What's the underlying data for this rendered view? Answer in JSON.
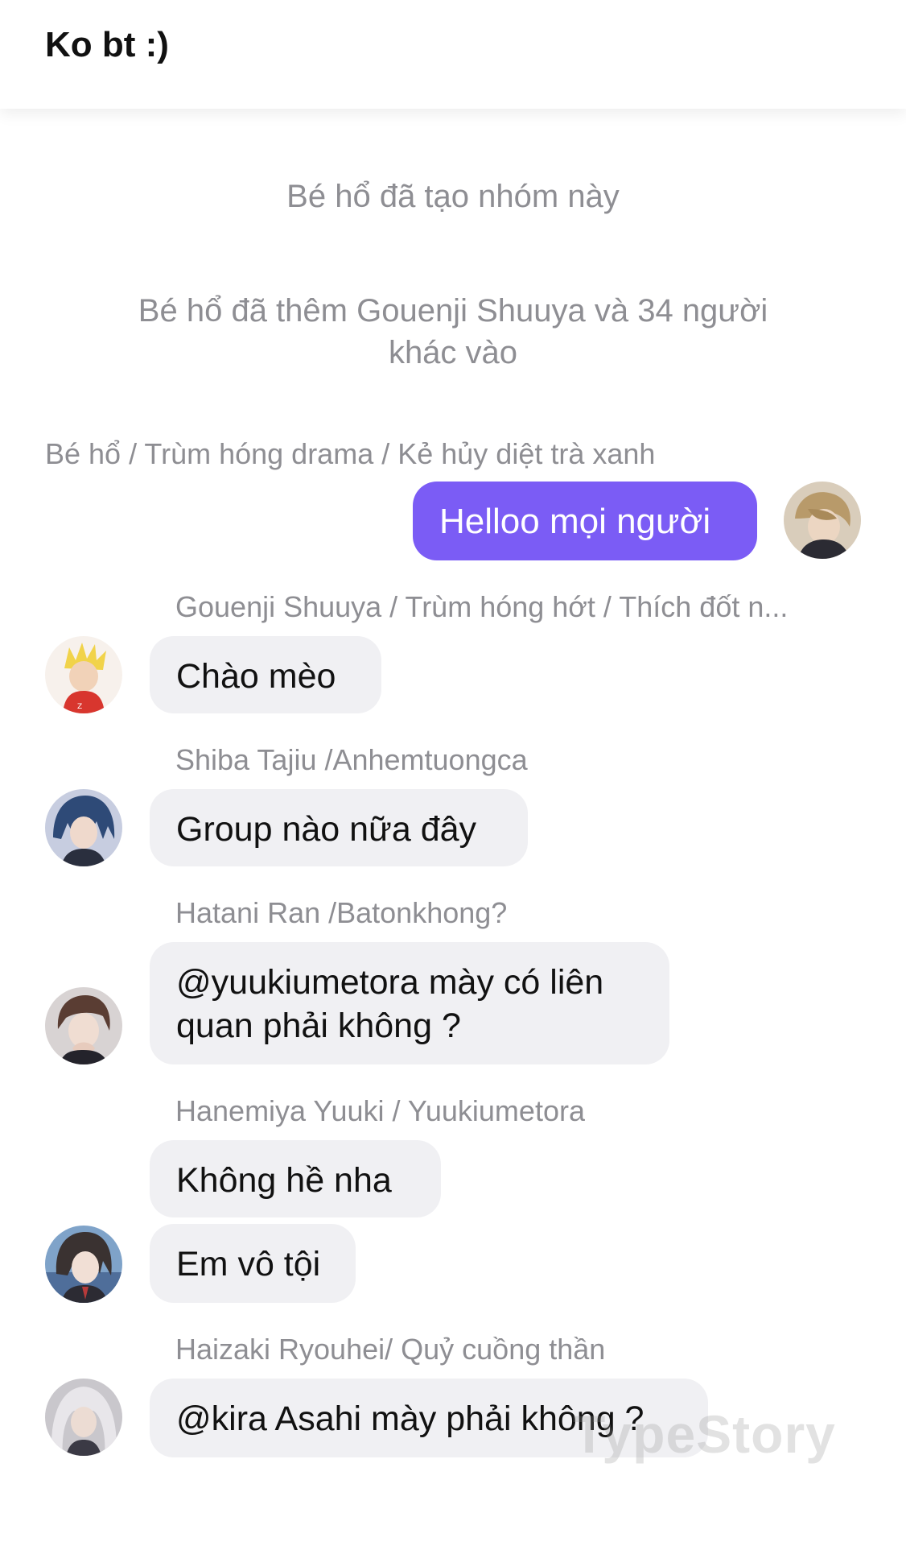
{
  "header": {
    "title": "Ko bt :)"
  },
  "system_messages": [
    "Bé hổ đã tạo nhóm này",
    "Bé hổ đã thêm Gouenji Shuuya và 34 người khác vào"
  ],
  "messages": [
    {
      "sender": "Bé hổ / Trùm hóng drama / Kẻ hủy diệt trà xanh",
      "text": "Helloo mọi người",
      "direction": "outgoing",
      "avatar_icon": "user-avatar-icon"
    },
    {
      "sender": "Gouenji Shuuya / Trùm hóng hớt / Thích đốt n...",
      "text": "Chào mèo",
      "direction": "incoming",
      "avatar_icon": "user-avatar-icon"
    },
    {
      "sender": "Shiba Tajiu /Anhemtuongca",
      "text": "Group nào nữa đây",
      "direction": "incoming",
      "avatar_icon": "user-avatar-icon"
    },
    {
      "sender": "Hatani Ran /Batonkhong?",
      "text": "@yuukiumetora mày có liên quan phải không ?",
      "direction": "incoming",
      "avatar_icon": "user-avatar-icon"
    },
    {
      "sender": "Hanemiya Yuuki / Yuukiumetora",
      "text": "Không hề nha",
      "text2": "Em vô tội",
      "direction": "incoming",
      "avatar_icon": "user-avatar-icon"
    },
    {
      "sender": "Haizaki Ryouhei/ Quỷ cuồng thần",
      "text": "@kira Asahi mày phải không ?",
      "direction": "incoming",
      "avatar_icon": "user-avatar-icon"
    }
  ],
  "watermark": "TypeStory",
  "colors": {
    "outgoing_bubble": "#7b5cf5",
    "incoming_bubble": "#f0f0f3",
    "meta_text": "#8e8e93"
  }
}
